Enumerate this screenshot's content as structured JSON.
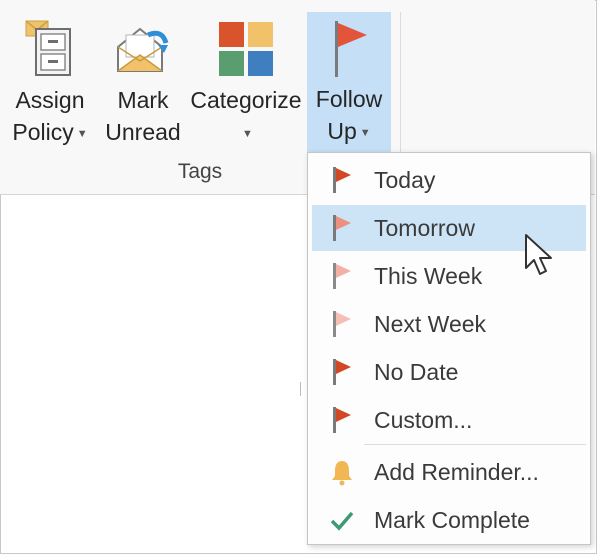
{
  "ribbon": {
    "buttons": [
      {
        "line1": "Assign",
        "line2": "Policy",
        "has_caret": true
      },
      {
        "line1": "Mark",
        "line2": "Unread",
        "has_caret": false
      },
      {
        "line1": "Categorize",
        "line2": "",
        "has_caret": true
      },
      {
        "line1": "Follow",
        "line2": "Up",
        "has_caret": true
      }
    ],
    "group_label": "Tags"
  },
  "menu": {
    "items": [
      {
        "label": "Today",
        "icon": "flag-today-icon",
        "color": "#d24726"
      },
      {
        "label": "Tomorrow",
        "icon": "flag-tomorrow-icon",
        "color": "#ec9181"
      },
      {
        "label": "This Week",
        "icon": "flag-this-week-icon",
        "color": "#f2b1a6"
      },
      {
        "label": "Next Week",
        "icon": "flag-next-week-icon",
        "color": "#f4c0b6"
      },
      {
        "label": "No Date",
        "icon": "flag-no-date-icon",
        "color": "#d24726"
      },
      {
        "label": "Custom...",
        "icon": "flag-custom-icon",
        "color": "#d24726"
      },
      {
        "label": "Add Reminder...",
        "icon": "bell-icon",
        "color": "#f0b752"
      },
      {
        "label": "Mark Complete",
        "icon": "checkmark-icon",
        "color": "#3c9a75"
      }
    ],
    "highlighted": "Tomorrow"
  },
  "colors": {
    "selected_bg": "#c5dff7",
    "hover_bg": "#cde4f7",
    "flag_red": "#d24726"
  }
}
